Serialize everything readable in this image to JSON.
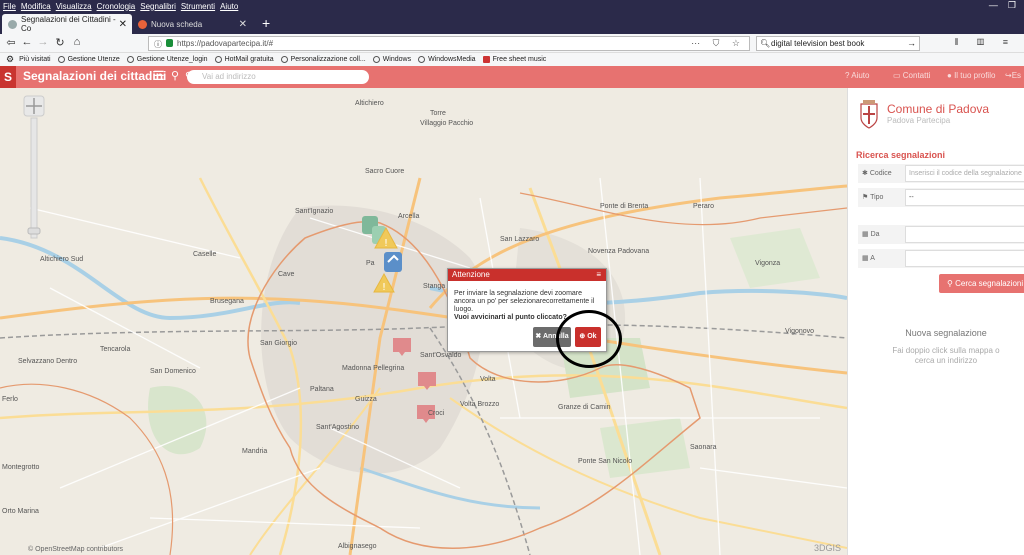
{
  "menu": [
    "File",
    "Modifica",
    "Visualizza",
    "Cronologia",
    "Segnalibri",
    "Strumenti",
    "Aiuto"
  ],
  "tabs": [
    {
      "label": "Segnalazioni dei Cittadini - Co",
      "active": true
    },
    {
      "label": "Nuova scheda",
      "active": false
    }
  ],
  "url": "https://padovapartecipa.it/#",
  "search": "digital television best book",
  "bookmarks": [
    "Più visitati",
    "Gestione Utenze",
    "Gestione Utenze_login",
    "HotMail gratuita",
    "Personalizzazione coll...",
    "Windows",
    "WindowsMedia",
    "Free sheet music"
  ],
  "app": {
    "logo": "S",
    "title": "Segnalazioni dei cittadini",
    "address_placeholder": "Vai ad indirizzo",
    "aiuto": "Aiuto",
    "contatti": "Contatti",
    "profilo": "Il tuo profilo",
    "esci": "Es"
  },
  "map": {
    "places": [
      "Altichiero",
      "Torre",
      "Villaggio Pacchio",
      "Sacro Cuore",
      "San Lazzaro",
      "Ponte di Brenta",
      "Sant'Ignazio",
      "Arcella",
      "Novenza Padovana",
      "Peraro",
      "Vigonza",
      "Vigonovo",
      "Caselle",
      "Cave",
      "Pa",
      "Stanga",
      "Altichiero Sud",
      "Brusegana",
      "Sant'Osvaldo",
      "Madonna Pellegrina",
      "San Giorgio",
      "Selvazzano Dentro",
      "Tencarola",
      "San Domenico",
      "Paltana",
      "Guizza",
      "Croci",
      "Volta",
      "Volta Brozzo",
      "Saonara",
      "Sant'Agostino",
      "Mandria",
      "Granze di Camin",
      "Ponte San Nicolo",
      "Albignasego",
      "Montegrotto",
      "Ferlo",
      "Orto Marina"
    ],
    "attribution": "© OpenStreetMap contributors",
    "brand": "3DGIS"
  },
  "panel": {
    "comune": "Comune di Padova",
    "sub": "Padova Partecipa",
    "ricerca": "Ricerca segnalazioni",
    "codice_label": "Codice",
    "codice_placeholder": "Inserisci il codice della segnalazione",
    "tipo_label": "Tipo",
    "tipo_value": "--",
    "da_label": "Da",
    "a_label": "A",
    "cerca": "Cerca segnalazioni",
    "nuova": "Nuova segnalazione",
    "nuova_hint": "Fai doppio click sulla mappa o cerca un indirizzo"
  },
  "dialog": {
    "title": "Attenzione",
    "text": "Per inviare la segnalazione devi zoomare ancora un po' per selezionarecorrettamente il luogo.",
    "question": "Vuoi avvicinarti al punto cliccato?",
    "annulla": "Annulla",
    "ok": "Ok"
  }
}
